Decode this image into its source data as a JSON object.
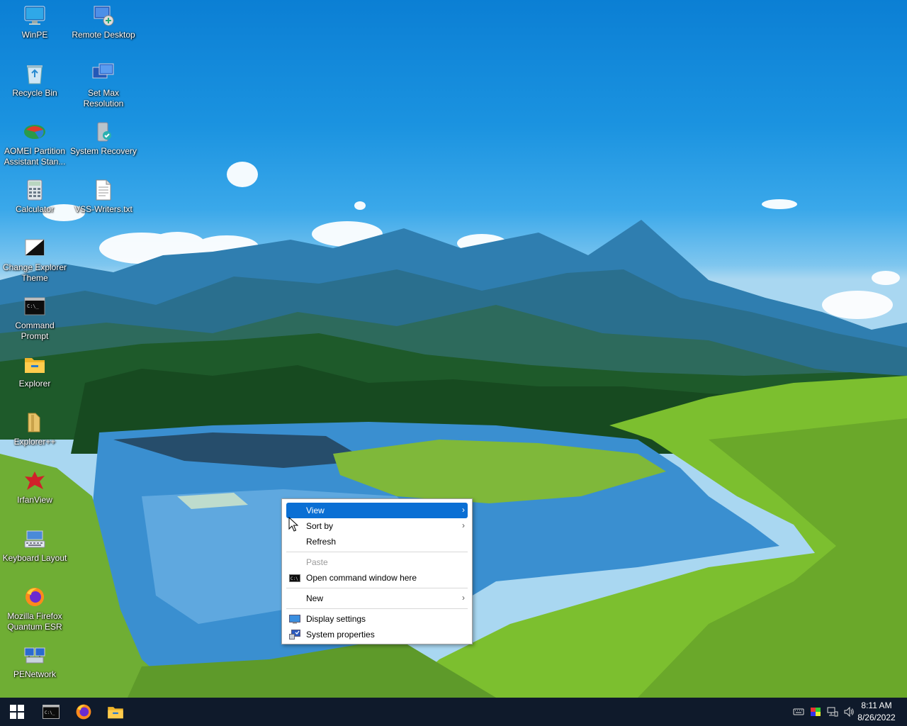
{
  "desktop": {
    "icons": [
      {
        "label": "WinPE",
        "icon": "monitor-icon"
      },
      {
        "label": "Remote Desktop",
        "icon": "remote-desktop-icon"
      },
      {
        "label": "Recycle Bin",
        "icon": "recycle-bin-icon"
      },
      {
        "label": "Set Max\nResolution",
        "icon": "set-resolution-icon"
      },
      {
        "label": "AOMEI Partition\nAssistant Stan...",
        "icon": "aomei-icon"
      },
      {
        "label": "System Recovery",
        "icon": "system-recovery-icon"
      },
      {
        "label": "Calculator",
        "icon": "calculator-icon"
      },
      {
        "label": "VSS-Writers.txt",
        "icon": "text-file-icon"
      },
      {
        "label": "Change Explorer\nTheme",
        "icon": "theme-icon"
      },
      {
        "label": "Command\nPrompt",
        "icon": "command-prompt-icon"
      },
      {
        "label": "Explorer",
        "icon": "folder-icon"
      },
      {
        "label": "Explorer++",
        "icon": "explorer-plus-icon"
      },
      {
        "label": "IrfanView",
        "icon": "irfanview-icon"
      },
      {
        "label": "Keyboard Layout",
        "icon": "keyboard-icon"
      },
      {
        "label": "Mozilla Firefox\nQuantum ESR",
        "icon": "firefox-icon"
      },
      {
        "label": "PENetwork",
        "icon": "network-icon"
      }
    ]
  },
  "context_menu": {
    "items": [
      {
        "label": "View",
        "has_submenu": true,
        "highlighted": true
      },
      {
        "label": "Sort by",
        "has_submenu": true
      },
      {
        "label": "Refresh"
      },
      {
        "label": "Paste",
        "disabled": true
      },
      {
        "label": "Open command window here",
        "icon": "cmd-icon"
      },
      {
        "label": "New",
        "has_submenu": true
      },
      {
        "label": "Display settings",
        "icon": "display-icon"
      },
      {
        "label": "System properties",
        "icon": "system-properties-icon"
      }
    ],
    "arrow": "›"
  },
  "taskbar": {
    "pinned": [
      "start-button",
      "command-prompt",
      "firefox",
      "file-explorer"
    ],
    "clock": {
      "time": "8:11 AM",
      "date": "8/26/2022"
    }
  },
  "colors": {
    "highlight": "#0a6fd4",
    "taskbar": "#0f1a2b"
  }
}
